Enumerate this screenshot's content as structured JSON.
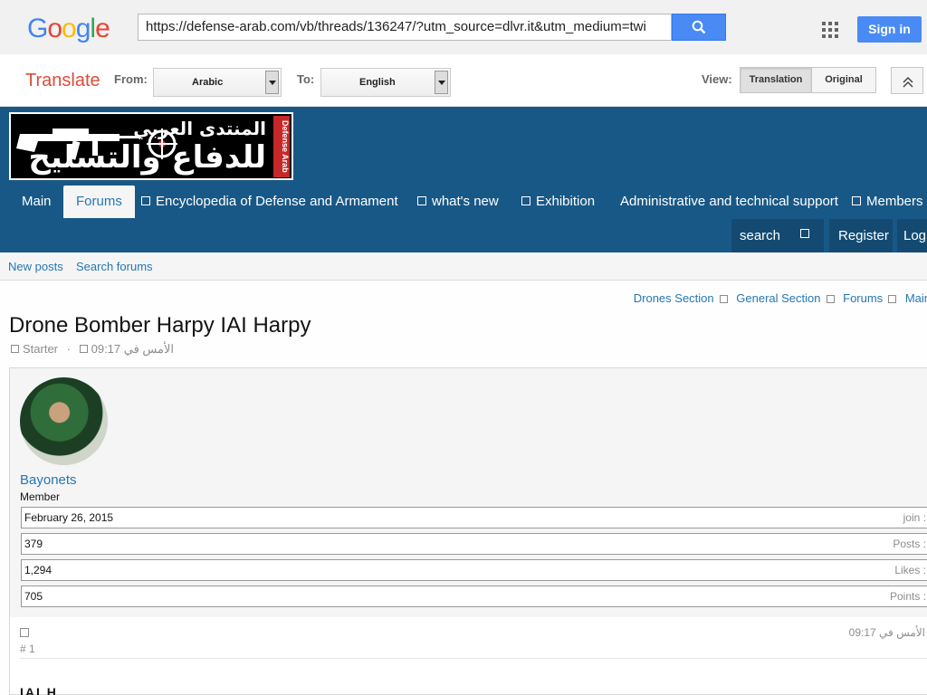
{
  "google": {
    "url": "https://defense-arab.com/vb/threads/136247/?utm_source=dlvr.it&utm_medium=twi",
    "signin": "Sign in"
  },
  "translate": {
    "label": "Translate",
    "from_label": "From:",
    "from_value": "Arabic",
    "to_label": "To:",
    "to_value": "English",
    "view_label": "View:",
    "view_translation": "Translation",
    "view_original": "Original"
  },
  "logo": {
    "line1": "المنتدى العربي",
    "line2": "للدفاع والتسليح",
    "brand": "Defense Arab"
  },
  "nav": {
    "main": "Main",
    "forums": "Forums",
    "encyclopedia": "Encyclopedia of Defense and Armament",
    "whats_new": "what's new",
    "exhibition": "Exhibition",
    "support": "Administrative and technical support",
    "members": "Members",
    "search": "search",
    "register": "Register",
    "login": "Log"
  },
  "tabs": {
    "new_posts": "New posts",
    "search_forums": "Search forums"
  },
  "breadcrumb": [
    "Drones Section",
    "General Section",
    "Forums",
    "Main"
  ],
  "thread": {
    "title": "Drone Bomber Harpy IAI Harpy",
    "starter": "Starter",
    "date": "الأمس في 09:17"
  },
  "post": {
    "username": "Bayonets",
    "role": "Member",
    "stats": [
      {
        "value": "February 26, 2015",
        "key": "join :"
      },
      {
        "value": "379",
        "key": "Posts :"
      },
      {
        "value": "1,294",
        "key": "Likes :"
      },
      {
        "value": "705",
        "key": "Points :"
      }
    ],
    "date": "الأمس في 09:17",
    "number": "# 1",
    "body_start": "IAI H"
  },
  "colors": {
    "header_bg": "#185886",
    "link": "#2577b1",
    "google_blue": "#4a8af4"
  }
}
